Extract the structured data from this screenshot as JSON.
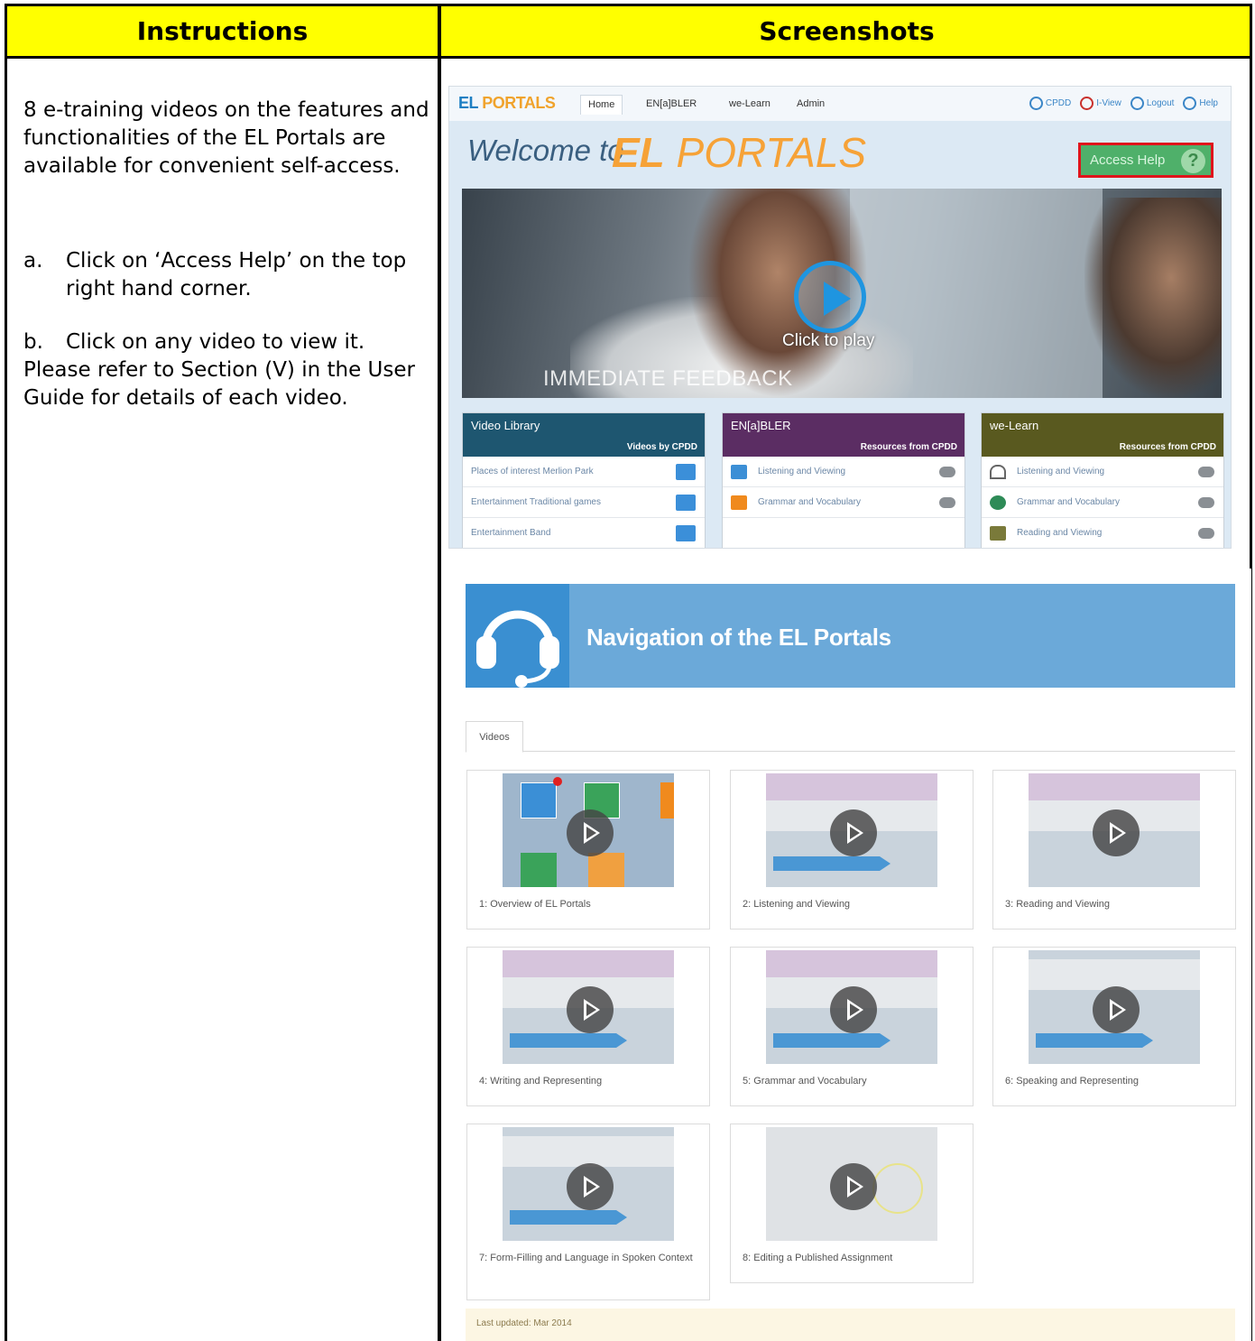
{
  "header": {
    "instructions": "Instructions",
    "screenshots": "Screenshots"
  },
  "instructions": {
    "intro": "8 e-training videos on the features and functionalities of the EL Portals are available for convenient self-access.",
    "steps": [
      {
        "label": "a.",
        "text": "Click on ‘Access Help’ on the top right hand corner."
      },
      {
        "label": "b.",
        "text": "Click on any video to view it."
      }
    ],
    "note": "Please refer to Section (V) in the User Guide for details of each video."
  },
  "portal": {
    "logo": {
      "a": "EL",
      "b": " PORTALS"
    },
    "tabs": [
      "Home",
      "EN[a]BLER",
      "we-Learn",
      "Admin"
    ],
    "top_links": [
      "CPDD",
      "I-View",
      "Logout",
      "Help"
    ],
    "welcome": "Welcome to",
    "welcome_brand_a": "EL",
    "welcome_brand_b": " PORTALS",
    "access_help": "Access Help",
    "click_to_play": "Click to play",
    "immediate_feedback": "IMMEDIATE FEEDBACK",
    "panels": [
      {
        "title": "Video Library",
        "sub": "Videos by CPDD",
        "color": "#1e5670",
        "rows": [
          "Places of interest Merlion Park",
          "Entertainment Traditional games",
          "Entertainment Band"
        ]
      },
      {
        "title": "EN[a]BLER",
        "sub": "Resources from CPDD",
        "color": "#5b2d63",
        "rows": [
          "Listening and Viewing",
          "Grammar and Vocabulary",
          ""
        ]
      },
      {
        "title": "we-Learn",
        "sub": "Resources from CPDD",
        "color": "#59591f",
        "rows": [
          "Listening and Viewing",
          "Grammar and Vocabulary",
          "Reading and Viewing"
        ]
      }
    ]
  },
  "help": {
    "title": "Navigation of the EL Portals",
    "tab": "Videos",
    "videos": [
      "1: Overview of EL Portals",
      "2: Listening and Viewing",
      "3: Reading and Viewing",
      "4: Writing and Representing",
      "5: Grammar and Vocabulary",
      "6: Speaking and Representing",
      "7: Form-Filling and Language in Spoken Context",
      "8: Editing a Published Assignment"
    ],
    "last_updated": "Last updated: Mar 2014"
  },
  "colors": {
    "header_bg": "#ffff00",
    "banner": "#6ba9d9",
    "access_help_border": "#e0141b"
  }
}
